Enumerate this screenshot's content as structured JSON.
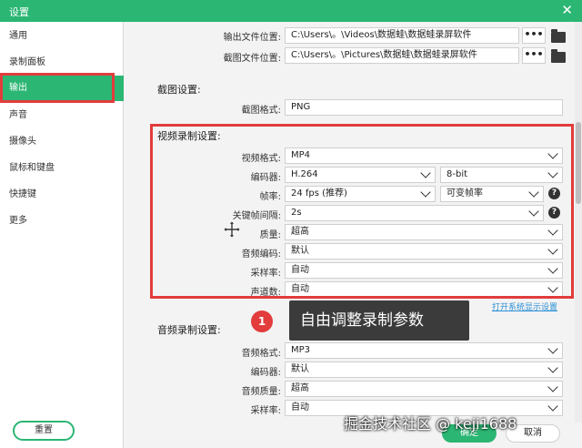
{
  "window": {
    "title": "设置"
  },
  "sidebar": {
    "items": [
      {
        "label": "通用"
      },
      {
        "label": "录制面板"
      },
      {
        "label": "输出"
      },
      {
        "label": "声音"
      },
      {
        "label": "摄像头"
      },
      {
        "label": "鼠标和键盘"
      },
      {
        "label": "快捷键"
      },
      {
        "label": "更多"
      }
    ],
    "active_index": 2,
    "reset_label": "重置"
  },
  "output": {
    "video_path_label": "输出文件位置:",
    "video_path_value": "C:\\Users\\。\\Videos\\数据蛙\\数据蛙录屏软件",
    "screenshot_path_label": "截图文件位置:",
    "screenshot_path_value": "C:\\Users\\。\\Pictures\\数据蛙\\数据蛙录屏软件",
    "more_label": "•••"
  },
  "screenshot_settings": {
    "title": "截图设置:",
    "format_label": "截图格式:",
    "format_value": "PNG"
  },
  "video_settings": {
    "title": "视频录制设置:",
    "rows": [
      {
        "label": "视频格式:",
        "value": "MP4"
      },
      {
        "label": "编码器:",
        "value": "H.264",
        "extra": "8-bit"
      },
      {
        "label": "帧率:",
        "value": "24 fps (推荐)",
        "extra": "可变帧率"
      },
      {
        "label": "关键帧间隔:",
        "value": "2s"
      },
      {
        "label": "质量:",
        "value": "超高"
      },
      {
        "label": "音频编码:",
        "value": "默认"
      },
      {
        "label": "采样率:",
        "value": "自动"
      },
      {
        "label": "声道数:",
        "value": "自动"
      }
    ],
    "system_settings_link": "打开系统显示设置"
  },
  "audio_settings": {
    "title": "音频录制设置:",
    "rows": [
      {
        "label": "音频格式:",
        "value": "MP3"
      },
      {
        "label": "编码器:",
        "value": "默认"
      },
      {
        "label": "音频质量:",
        "value": "超高"
      },
      {
        "label": "采样率:",
        "value": "自动"
      }
    ]
  },
  "annotation": {
    "badge": "1",
    "text": "自由调整录制参数"
  },
  "footer": {
    "confirm_label": "确定",
    "cancel_label": "取消"
  },
  "watermark": "掘金技术社区 @ keji1688",
  "colors": {
    "brand": "#2bb673",
    "highlight": "#e23c3c",
    "link": "#2a8fd6"
  }
}
